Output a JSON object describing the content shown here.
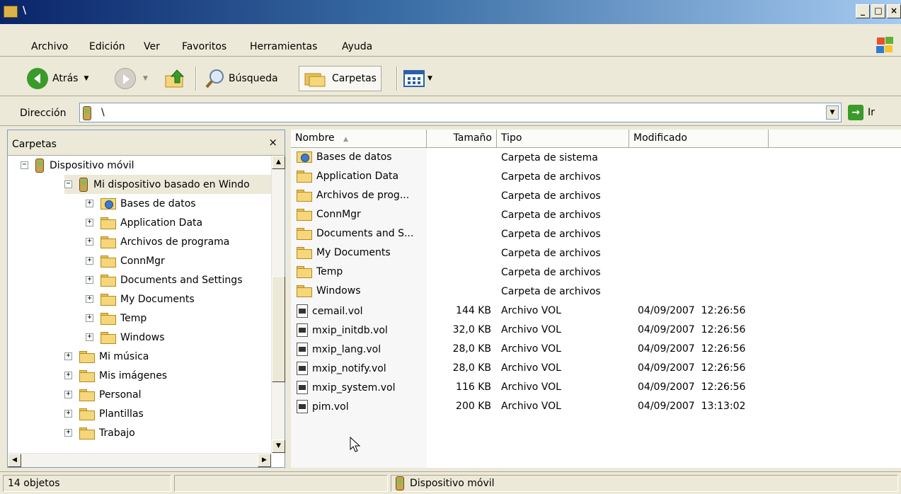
{
  "window": {
    "title": "\\"
  },
  "menu": [
    "Archivo",
    "Edición",
    "Ver",
    "Favoritos",
    "Herramientas",
    "Ayuda"
  ],
  "toolbar": {
    "back_label": "Atrás",
    "search_label": "Búsqueda",
    "folders_label": "Carpetas"
  },
  "address": {
    "label": "Dirección",
    "value": "\\",
    "go_label": "Ir"
  },
  "folders_pane": {
    "title": "Carpetas",
    "close": "×",
    "tree": [
      {
        "label": "Dispositivo móvil",
        "expander": "−",
        "icon": "device-icon"
      },
      {
        "label": "Mi dispositivo basado en Windo",
        "expander": "−",
        "icon": "device-icon"
      },
      {
        "label": "Bases de datos",
        "expander": "+",
        "icon": "database-folder-icon"
      },
      {
        "label": "Application Data",
        "expander": "+",
        "icon": "folder-icon"
      },
      {
        "label": "Archivos de programa",
        "expander": "+",
        "icon": "folder-icon"
      },
      {
        "label": "ConnMgr",
        "expander": "+",
        "icon": "folder-icon"
      },
      {
        "label": "Documents and Settings",
        "expander": "+",
        "icon": "folder-icon"
      },
      {
        "label": "My Documents",
        "expander": "+",
        "icon": "folder-icon"
      },
      {
        "label": "Temp",
        "expander": "+",
        "icon": "folder-icon"
      },
      {
        "label": "Windows",
        "expander": "+",
        "icon": "folder-icon"
      },
      {
        "label": "Mi música",
        "expander": "+",
        "icon": "folder-icon"
      },
      {
        "label": "Mis imágenes",
        "expander": "+",
        "icon": "folder-icon"
      },
      {
        "label": "Personal",
        "expander": "+",
        "icon": "folder-icon"
      },
      {
        "label": "Plantillas",
        "expander": "+",
        "icon": "folder-icon"
      },
      {
        "label": "Trabajo",
        "expander": "+",
        "icon": "folder-icon"
      }
    ]
  },
  "list": {
    "columns": [
      "Nombre",
      "Tamaño",
      "Tipo",
      "Modificado"
    ],
    "rows": [
      {
        "name": "Bases de datos",
        "size": "",
        "type": "Carpeta de sistema",
        "modified": "",
        "icon": "database-folder-icon"
      },
      {
        "name": "Application Data",
        "size": "",
        "type": "Carpeta de archivos",
        "modified": "",
        "icon": "folder-icon"
      },
      {
        "name": "Archivos de prog...",
        "size": "",
        "type": "Carpeta de archivos",
        "modified": "",
        "icon": "folder-icon"
      },
      {
        "name": "ConnMgr",
        "size": "",
        "type": "Carpeta de archivos",
        "modified": "",
        "icon": "folder-icon"
      },
      {
        "name": "Documents and S...",
        "size": "",
        "type": "Carpeta de archivos",
        "modified": "",
        "icon": "folder-icon"
      },
      {
        "name": "My Documents",
        "size": "",
        "type": "Carpeta de archivos",
        "modified": "",
        "icon": "folder-icon"
      },
      {
        "name": "Temp",
        "size": "",
        "type": "Carpeta de archivos",
        "modified": "",
        "icon": "folder-icon"
      },
      {
        "name": "Windows",
        "size": "",
        "type": "Carpeta de archivos",
        "modified": "",
        "icon": "folder-icon"
      },
      {
        "name": "cemail.vol",
        "size": "144 KB",
        "type": "Archivo VOL",
        "modified": "04/09/2007  12:26:56",
        "icon": "vol-file-icon"
      },
      {
        "name": "mxip_initdb.vol",
        "size": "32,0 KB",
        "type": "Archivo VOL",
        "modified": "04/09/2007  12:26:56",
        "icon": "vol-file-icon"
      },
      {
        "name": "mxip_lang.vol",
        "size": "28,0 KB",
        "type": "Archivo VOL",
        "modified": "04/09/2007  12:26:56",
        "icon": "vol-file-icon"
      },
      {
        "name": "mxip_notify.vol",
        "size": "28,0 KB",
        "type": "Archivo VOL",
        "modified": "04/09/2007  12:26:56",
        "icon": "vol-file-icon"
      },
      {
        "name": "mxip_system.vol",
        "size": "116 KB",
        "type": "Archivo VOL",
        "modified": "04/09/2007  12:26:56",
        "icon": "vol-file-icon"
      },
      {
        "name": "pim.vol",
        "size": "200 KB",
        "type": "Archivo VOL",
        "modified": "04/09/2007  13:13:02",
        "icon": "vol-file-icon"
      }
    ]
  },
  "status": {
    "count": "14 objetos",
    "location": "Dispositivo móvil"
  },
  "colors": {
    "title_start": "#0a246a",
    "title_end": "#a6caf0",
    "chrome": "#ece9d8"
  }
}
